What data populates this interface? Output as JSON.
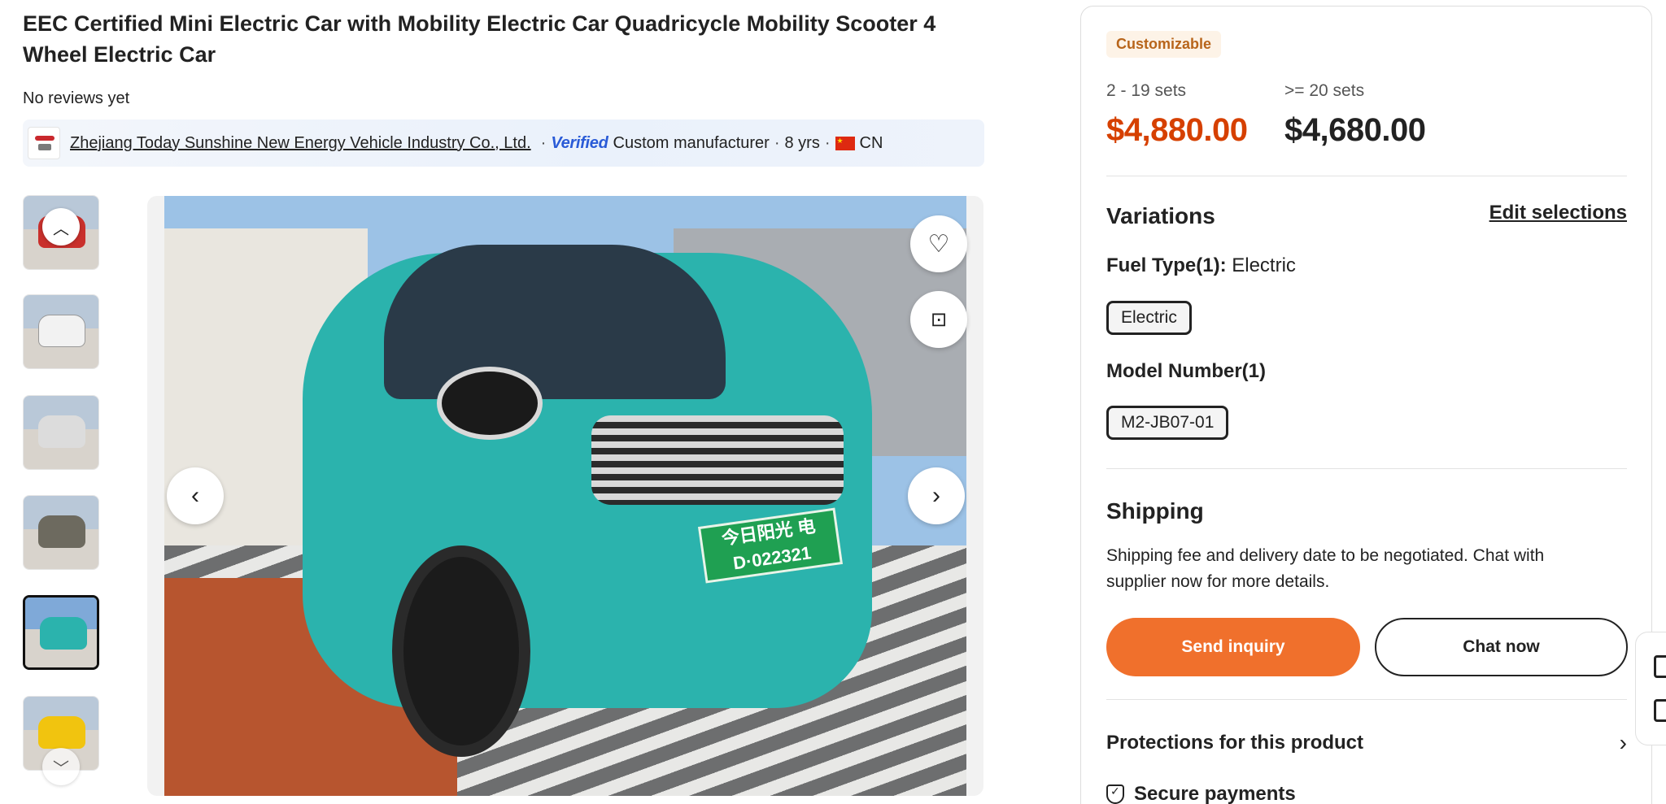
{
  "product": {
    "title": "EEC Certified Mini Electric Car with Mobility Electric Car Quadricycle Mobility Scooter 4 Wheel Electric Car",
    "reviews": "No reviews yet"
  },
  "supplier": {
    "name": "Zhejiang Today Sunshine New Energy Vehicle Industry Co., Ltd.",
    "verified_label": "Verified",
    "type": "Custom manufacturer",
    "years": "8 yrs",
    "country": "CN",
    "separator": "·"
  },
  "gallery": {
    "plate_text": "今日阳光 电D·022321",
    "thumb_colors": [
      "#c9302c",
      "#f2f2f2",
      "#dcdcdc",
      "#6d6a5f",
      "#2bb3ad",
      "#f1c40f"
    ],
    "active_index": 4
  },
  "pricing": {
    "badge": "Customizable",
    "tiers": [
      {
        "range": "2 - 19 sets",
        "price": "$4,880.00",
        "color": "#d64000"
      },
      {
        "range": ">= 20 sets",
        "price": "$4,680.00",
        "color": "#222222"
      }
    ]
  },
  "variations": {
    "title": "Variations",
    "edit_label": "Edit selections",
    "fuel_type_label": "Fuel Type(1):",
    "fuel_type_value": "Electric",
    "fuel_type_option": "Electric",
    "model_number_label": "Model Number(1)",
    "model_number_option": "M2-JB07-01"
  },
  "shipping": {
    "title": "Shipping",
    "text": "Shipping fee and delivery date to be negotiated. Chat with supplier now for more details."
  },
  "actions": {
    "send_inquiry": "Send inquiry",
    "chat_now": "Chat now"
  },
  "protections": {
    "title": "Protections for this product",
    "secure_payments": "Secure payments"
  },
  "colors": {
    "accent_orange": "#f0702c",
    "price_red": "#d64000",
    "badge_text": "#b8651b"
  }
}
